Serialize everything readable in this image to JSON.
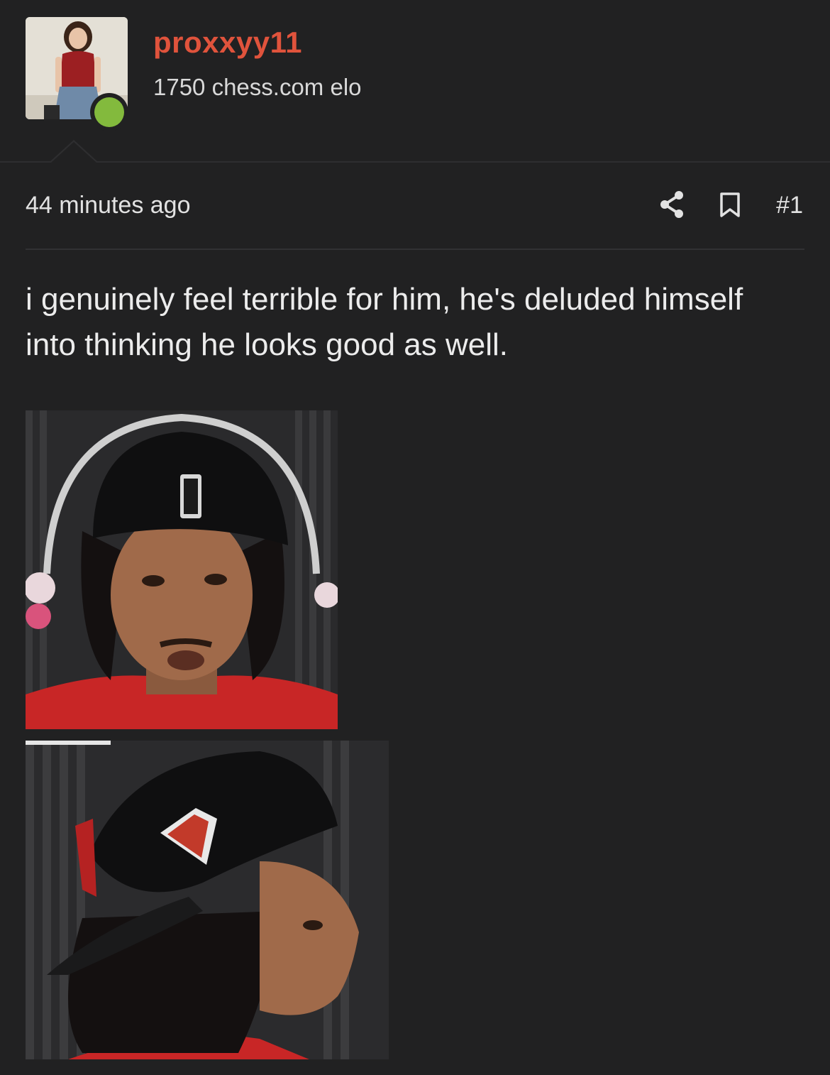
{
  "author": {
    "username": "proxxyy11",
    "subtitle": "1750 chess.com elo",
    "avatar_icon": "profile-photo",
    "online_color": "#83ba3d",
    "username_color": "#e0533c"
  },
  "meta": {
    "timestamp": "44 minutes ago",
    "share_icon": "share-icon",
    "bookmark_icon": "bookmark-icon",
    "post_number": "#1"
  },
  "post": {
    "text": "i genuinely feel terrible for him, he's deluded himself into thinking he looks good as well.",
    "images": [
      {
        "name": "photo-1"
      },
      {
        "name": "photo-2"
      }
    ]
  },
  "colors": {
    "background": "#212122",
    "divider": "#2e2e30"
  }
}
